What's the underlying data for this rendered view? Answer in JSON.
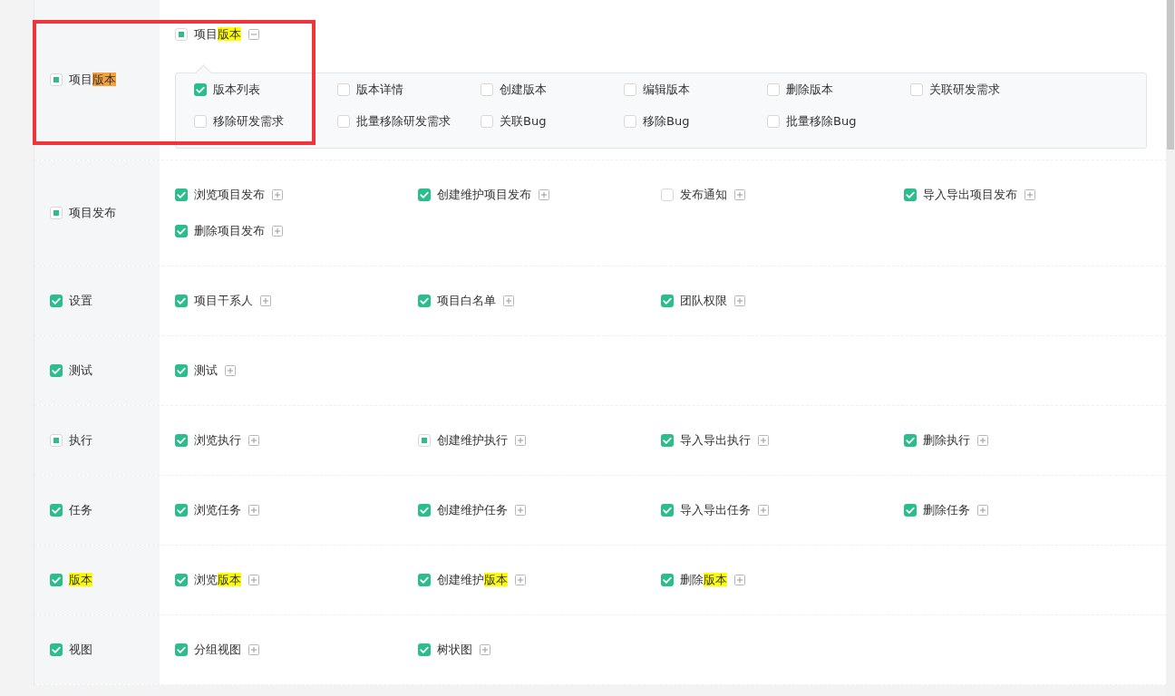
{
  "callout_frame": true,
  "modules": [
    {
      "label": [
        {
          "text": "项目",
          "highlighted": false
        },
        {
          "text": "版本",
          "highlighted": true,
          "color": "#f5a13c"
        }
      ],
      "kind": "mixed",
      "checked": true,
      "items": [
        {
          "label": [
            {
              "text": "项目",
              "highlighted": false
            },
            {
              "text": "版本",
              "highlighted": true,
              "color": "#ffff00"
            }
          ],
          "kind": "mixed",
          "checked": true,
          "expanded": true,
          "children": [
            {
              "label": [
                {
                  "text": "版本列表",
                  "highlighted": false
                }
              ],
              "kind": "plain",
              "checked": true
            },
            {
              "label": [
                {
                  "text": "版本详情",
                  "highlighted": false
                }
              ],
              "kind": "plain",
              "checked": false
            },
            {
              "label": [
                {
                  "text": "创建版本",
                  "highlighted": false
                }
              ],
              "kind": "plain",
              "checked": false
            },
            {
              "label": [
                {
                  "text": "编辑版本",
                  "highlighted": false
                }
              ],
              "kind": "plain",
              "checked": false
            },
            {
              "label": [
                {
                  "text": "删除版本",
                  "highlighted": false
                }
              ],
              "kind": "plain",
              "checked": false
            },
            {
              "label": [
                {
                  "text": "关联研发需求",
                  "highlighted": false
                }
              ],
              "kind": "plain",
              "checked": false
            },
            {
              "label": [
                {
                  "text": "移除研发需求",
                  "highlighted": false
                }
              ],
              "kind": "plain",
              "checked": false
            },
            {
              "label": [
                {
                  "text": "批量移除研发需求",
                  "highlighted": false
                }
              ],
              "kind": "plain",
              "checked": false
            },
            {
              "label": [
                {
                  "text": "关联Bug",
                  "highlighted": false
                }
              ],
              "kind": "plain",
              "checked": false
            },
            {
              "label": [
                {
                  "text": "移除Bug",
                  "highlighted": false
                }
              ],
              "kind": "plain",
              "checked": false
            },
            {
              "label": [
                {
                  "text": "批量移除Bug",
                  "highlighted": false
                }
              ],
              "kind": "plain",
              "checked": false
            }
          ]
        }
      ]
    },
    {
      "label": [
        {
          "text": "项目发布",
          "highlighted": false
        }
      ],
      "kind": "mixed",
      "checked": true,
      "items": [
        {
          "label": [
            {
              "text": "浏览项目发布",
              "highlighted": false
            }
          ],
          "kind": "plain",
          "checked": true,
          "expanded": false
        },
        {
          "label": [
            {
              "text": "创建维护项目发布",
              "highlighted": false
            }
          ],
          "kind": "plain",
          "checked": true,
          "expanded": false
        },
        {
          "label": [
            {
              "text": "发布通知",
              "highlighted": false
            }
          ],
          "kind": "plain",
          "checked": false,
          "expanded": false
        },
        {
          "label": [
            {
              "text": "导入导出项目发布",
              "highlighted": false
            }
          ],
          "kind": "plain",
          "checked": true,
          "expanded": false
        },
        {
          "label": [
            {
              "text": "删除项目发布",
              "highlighted": false
            }
          ],
          "kind": "plain",
          "checked": true,
          "expanded": false
        }
      ]
    },
    {
      "label": [
        {
          "text": "设置",
          "highlighted": false
        }
      ],
      "kind": "plain",
      "checked": true,
      "items": [
        {
          "label": [
            {
              "text": "项目干系人",
              "highlighted": false
            }
          ],
          "kind": "plain",
          "checked": true,
          "expanded": false
        },
        {
          "label": [
            {
              "text": "项目白名单",
              "highlighted": false
            }
          ],
          "kind": "plain",
          "checked": true,
          "expanded": false
        },
        {
          "label": [
            {
              "text": "团队权限",
              "highlighted": false
            }
          ],
          "kind": "plain",
          "checked": true,
          "expanded": false
        }
      ]
    },
    {
      "label": [
        {
          "text": "测试",
          "highlighted": false
        }
      ],
      "kind": "plain",
      "checked": true,
      "items": [
        {
          "label": [
            {
              "text": "测试",
              "highlighted": false
            }
          ],
          "kind": "plain",
          "checked": true,
          "expanded": false
        }
      ]
    },
    {
      "label": [
        {
          "text": "执行",
          "highlighted": false
        }
      ],
      "kind": "mixed",
      "checked": true,
      "items": [
        {
          "label": [
            {
              "text": "浏览执行",
              "highlighted": false
            }
          ],
          "kind": "plain",
          "checked": true,
          "expanded": false
        },
        {
          "label": [
            {
              "text": "创建维护执行",
              "highlighted": false
            }
          ],
          "kind": "mixed",
          "checked": true,
          "expanded": false
        },
        {
          "label": [
            {
              "text": "导入导出执行",
              "highlighted": false
            }
          ],
          "kind": "plain",
          "checked": true,
          "expanded": false
        },
        {
          "label": [
            {
              "text": "删除执行",
              "highlighted": false
            }
          ],
          "kind": "plain",
          "checked": true,
          "expanded": false
        }
      ]
    },
    {
      "label": [
        {
          "text": "任务",
          "highlighted": false
        }
      ],
      "kind": "plain",
      "checked": true,
      "items": [
        {
          "label": [
            {
              "text": "浏览任务",
              "highlighted": false
            }
          ],
          "kind": "plain",
          "checked": true,
          "expanded": false
        },
        {
          "label": [
            {
              "text": "创建维护任务",
              "highlighted": false
            }
          ],
          "kind": "plain",
          "checked": true,
          "expanded": false
        },
        {
          "label": [
            {
              "text": "导入导出任务",
              "highlighted": false
            }
          ],
          "kind": "plain",
          "checked": true,
          "expanded": false
        },
        {
          "label": [
            {
              "text": "删除任务",
              "highlighted": false
            }
          ],
          "kind": "plain",
          "checked": true,
          "expanded": false
        }
      ]
    },
    {
      "label": [
        {
          "text": "版本",
          "highlighted": true,
          "color": "#ffff00"
        }
      ],
      "kind": "plain",
      "checked": true,
      "items": [
        {
          "label": [
            {
              "text": "浏览",
              "highlighted": false
            },
            {
              "text": "版本",
              "highlighted": true,
              "color": "#ffff00"
            }
          ],
          "kind": "plain",
          "checked": true,
          "expanded": false
        },
        {
          "label": [
            {
              "text": "创建维护",
              "highlighted": false
            },
            {
              "text": "版本",
              "highlighted": true,
              "color": "#ffff00"
            }
          ],
          "kind": "plain",
          "checked": true,
          "expanded": false
        },
        {
          "label": [
            {
              "text": "删除",
              "highlighted": false
            },
            {
              "text": "版本",
              "highlighted": true,
              "color": "#ffff00"
            }
          ],
          "kind": "plain",
          "checked": true,
          "expanded": false
        }
      ]
    },
    {
      "label": [
        {
          "text": "视图",
          "highlighted": false
        }
      ],
      "kind": "plain",
      "checked": true,
      "items": [
        {
          "label": [
            {
              "text": "分组视图",
              "highlighted": false
            }
          ],
          "kind": "plain",
          "checked": true,
          "expanded": false
        },
        {
          "label": [
            {
              "text": "树状图",
              "highlighted": false
            }
          ],
          "kind": "plain",
          "checked": true,
          "expanded": false
        }
      ]
    }
  ]
}
